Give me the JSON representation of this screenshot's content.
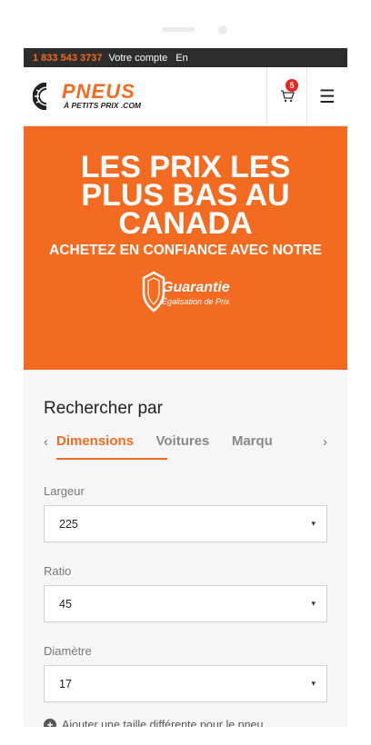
{
  "topbar": {
    "phone": "1 833 543 3737",
    "account": "Votre compte",
    "lang": "En"
  },
  "header": {
    "logo_main": "PNEUS",
    "logo_sub": "À PETITS PRIX .COM",
    "cart_count": "5",
    "cart_icon": "cart-icon",
    "menu_icon": "hamburger-menu-icon",
    "menu_glyph": "☰"
  },
  "hero": {
    "title": "LES PRIX LES PLUS BAS AU CANADA",
    "subtitle": "ACHETEZ EN CONFIANCE AVEC NOTRE",
    "badge_title": "Guarantie",
    "badge_sub": "Égalisation de Prix",
    "color": "#f26b21"
  },
  "search": {
    "title": "Rechercher par",
    "tab_prev": "‹",
    "tab_next": "›",
    "tabs": [
      "Dimensions",
      "Voitures",
      "Marqu"
    ],
    "fields": [
      {
        "label": "Largeur",
        "value": "225"
      },
      {
        "label": "Ratio",
        "value": "45"
      },
      {
        "label": "Diamètre",
        "value": "17"
      }
    ],
    "caret": "▾",
    "add_size_icon": "+",
    "add_size": "Ajouter une taille différente pour le pneu"
  }
}
